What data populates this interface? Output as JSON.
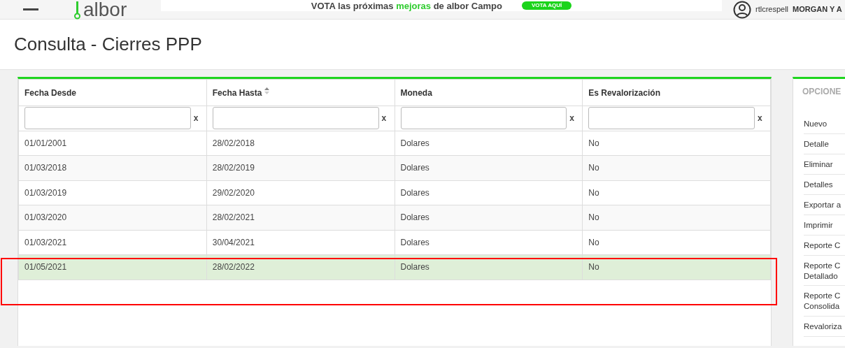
{
  "topbar": {
    "logo": "albor",
    "banner": {
      "text": "VOTA las próximas **mejoras** de albor Campo",
      "button": "VOTA AQUÍ"
    },
    "user": {
      "name": "rtlcrespell",
      "company": "MORGAN Y A"
    }
  },
  "page_title": "Consulta - Cierres PPP",
  "table": {
    "columns": [
      {
        "label": "Fecha Desde",
        "sortable": false,
        "filter_clear": "x"
      },
      {
        "label": "Fecha Hasta",
        "sortable": true,
        "filter_clear": "x"
      },
      {
        "label": "Moneda",
        "sortable": false,
        "filter_clear": "x"
      },
      {
        "label": "Es Revalorización",
        "sortable": false,
        "filter_clear": "x"
      }
    ],
    "rows": [
      {
        "cells": [
          "01/01/2001",
          "28/02/2018",
          "Dolares",
          "No"
        ],
        "selected": false
      },
      {
        "cells": [
          "01/03/2018",
          "28/02/2019",
          "Dolares",
          "No"
        ],
        "selected": false
      },
      {
        "cells": [
          "01/03/2019",
          "29/02/2020",
          "Dolares",
          "No"
        ],
        "selected": false
      },
      {
        "cells": [
          "01/03/2020",
          "28/02/2021",
          "Dolares",
          "No"
        ],
        "selected": false
      },
      {
        "cells": [
          "01/03/2021",
          "30/04/2021",
          "Dolares",
          "No"
        ],
        "selected": false
      },
      {
        "cells": [
          "01/05/2021",
          "28/02/2022",
          "Dolares",
          "No"
        ],
        "selected": true
      }
    ]
  },
  "options": {
    "title": "OPCIONE",
    "items": [
      "Nuevo",
      "Detalle",
      "Eliminar",
      "Detalles",
      "Exportar a",
      "Imprimir",
      "Reporte C",
      "Reporte C\nDetallado",
      "Reporte C\nConsolida",
      "Revaloriza"
    ]
  }
}
